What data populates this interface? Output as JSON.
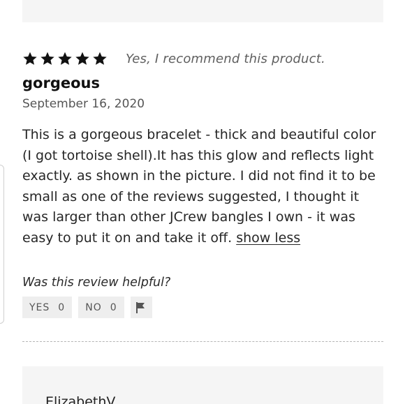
{
  "review": {
    "rating": 5,
    "rating_max": 5,
    "recommend_text": "Yes, I recommend this product.",
    "title": "gorgeous",
    "date": "September 16, 2020",
    "body": "This is a gorgeous bracelet - thick and beautiful color (I got tortoise shell).It has this glow and reflects light exactly. as shown in the picture. I did not find it to be small as one of the reviews suggested, I thought it was larger than other JCrew bangles I own - it was easy to put it on and take it off.",
    "show_less": "show less",
    "helpful_question": "Was this review helpful?",
    "yes_label": "YES",
    "yes_count": "0",
    "no_label": "NO",
    "no_count": "0",
    "flag_icon": "flag-icon",
    "star_icon": "star-icon",
    "star_color": "#111111"
  },
  "next_review": {
    "author": "ElizabethV"
  }
}
